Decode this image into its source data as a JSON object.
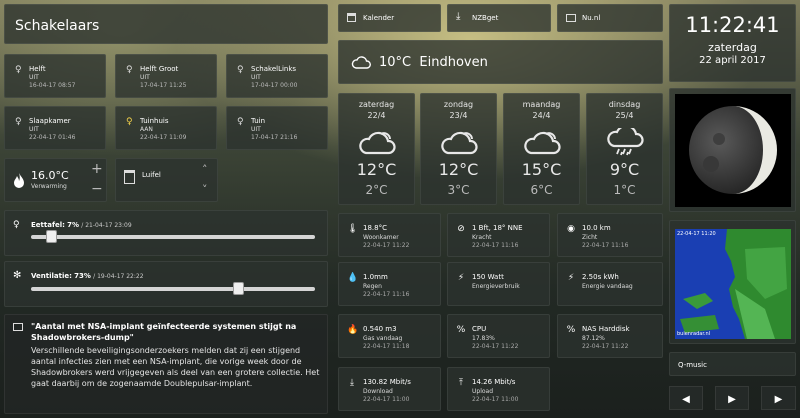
{
  "title": "Schakelaars",
  "top_links": [
    {
      "label": "Kalender",
      "icon": "calendar-icon"
    },
    {
      "label": "NZBget",
      "icon": "download-icon"
    },
    {
      "label": "Nu.nl",
      "icon": "newspaper-icon"
    }
  ],
  "clock": {
    "time": "11:22:41",
    "weekday": "zaterdag",
    "date": "22 april 2017"
  },
  "current_weather": {
    "text": "10°C  Eindhoven",
    "icon": "cloud-icon"
  },
  "switches": [
    {
      "name": "Helft",
      "state": "UIT",
      "time": "16-04-17 08:57",
      "icon": "bulb-icon",
      "on": false
    },
    {
      "name": "Helft Groot",
      "state": "UIT",
      "time": "17-04-17 11:25",
      "icon": "bulb-icon",
      "on": false
    },
    {
      "name": "SchakelLinks",
      "state": "UIT",
      "time": "17-04-17 00:00",
      "icon": "bulb-icon",
      "on": false
    },
    {
      "name": "Slaapkamer",
      "state": "UIT",
      "time": "22-04-17 01:46",
      "icon": "bulb-icon",
      "on": false
    },
    {
      "name": "Tuinhuis",
      "state": "AAN",
      "time": "22-04-17 11:09",
      "icon": "bulb-icon",
      "on": true
    },
    {
      "name": "Tuin",
      "state": "UIT",
      "time": "17-04-17 21:16",
      "icon": "bulb-icon",
      "on": false
    }
  ],
  "thermostat": {
    "value": "16.0°C",
    "label": "Verwarming",
    "plus": "+",
    "minus": "−"
  },
  "blinds": {
    "label": "Luifel"
  },
  "dimmer": {
    "label": "Eettafel:",
    "value": "7%",
    "time": "/ 21-04-17 23:09",
    "level": 7
  },
  "fan": {
    "label": "Ventilatie:",
    "value": "73%",
    "time": "/ 19-04-17 22:22",
    "level": 73
  },
  "news": {
    "headline": "\"Aantal met NSA-implant geïnfecteerde systemen stijgt na Shadowbrokers-dump\"",
    "body": "Verschillende beveiligingsonderzoekers melden dat zij een stijgend aantal infecties zien met een NSA-implant, die vorige week door de Shadowbrokers werd vrijgegeven als deel van een grotere collectie. Het gaat daarbij om de zogenaamde Doublepulsar-implant."
  },
  "forecast": [
    {
      "day": "zaterdag",
      "date": "22/4",
      "max": "12°C",
      "min": "2°C",
      "icon": "cloudy-icon"
    },
    {
      "day": "zondag",
      "date": "23/4",
      "max": "12°C",
      "min": "3°C",
      "icon": "cloudy-icon"
    },
    {
      "day": "maandag",
      "date": "24/4",
      "max": "15°C",
      "min": "6°C",
      "icon": "cloudy-icon"
    },
    {
      "day": "dinsdag",
      "date": "25/4",
      "max": "9°C",
      "min": "1°C",
      "icon": "rain-icon"
    }
  ],
  "stats": [
    {
      "value": "18.8°C",
      "label": "Woonkamer",
      "time": "22-04-17 11:22",
      "icon": "thermometer-icon",
      "glyph": "🌡"
    },
    {
      "value": "1 Bft, 18° NNE",
      "label": "Kracht",
      "time": "22-04-17 11:16",
      "icon": "wind-icon",
      "glyph": "⊘"
    },
    {
      "value": "10.0 km",
      "label": "Zicht",
      "time": "22-04-17 11:16",
      "icon": "eye-icon",
      "glyph": "◉"
    },
    {
      "value": "1.0mm",
      "label": "Regen",
      "time": "22-04-17 11:16",
      "icon": "raindrop-icon",
      "glyph": "💧"
    },
    {
      "value": "150 Watt",
      "label": "Energieverbruik",
      "time": "",
      "icon": "plug-icon",
      "glyph": "⚡"
    },
    {
      "value": "2.50s kWh",
      "label": "Energie vandaag",
      "time": "",
      "icon": "plug-icon",
      "glyph": "⚡"
    },
    {
      "value": "0.540 m3",
      "label": "Gas vandaag",
      "time": "22-04-17 11:18",
      "icon": "flame-icon",
      "glyph": "🔥"
    },
    {
      "value": "CPU",
      "label": "17.83%",
      "time": "22-04-17 11:22",
      "icon": "percent-icon",
      "glyph": "%"
    },
    {
      "value": "NAS Harddisk",
      "label": "87.12%",
      "time": "22-04-17 11:22",
      "icon": "percent-icon",
      "glyph": "%"
    },
    {
      "value": "130.82 Mbit/s",
      "label": "Download",
      "time": "22-04-17 11:00",
      "icon": "download-icon",
      "glyph": "⤓"
    },
    {
      "value": "14.26 Mbit/s",
      "label": "Upload",
      "time": "22-04-17 11:00",
      "icon": "upload-icon",
      "glyph": "⤒"
    }
  ],
  "radar": {
    "stamp": "22-04-17 11:20",
    "footer": "buienradar.nl"
  },
  "music": {
    "station": "Q-music",
    "prev": "◀",
    "play": "▶",
    "next": "▶"
  }
}
